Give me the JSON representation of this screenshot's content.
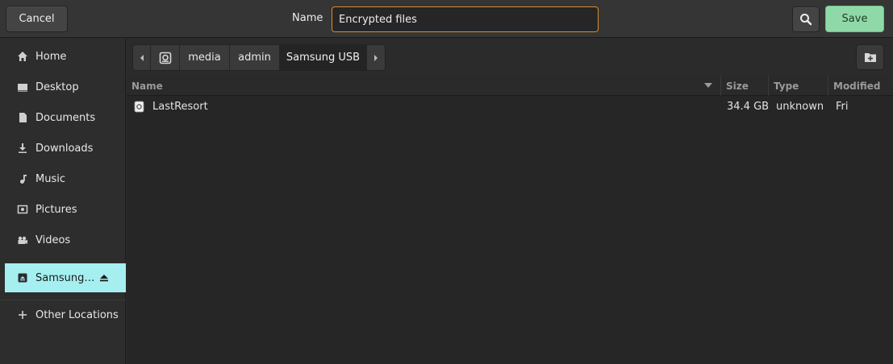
{
  "header": {
    "cancel_label": "Cancel",
    "name_label": "Name",
    "name_value": "Encrypted files",
    "save_label": "Save",
    "search_icon": "search-icon"
  },
  "sidebar": {
    "items": [
      {
        "label": "Home",
        "icon": "home-icon"
      },
      {
        "label": "Desktop",
        "icon": "desktop-icon"
      },
      {
        "label": "Documents",
        "icon": "document-icon"
      },
      {
        "label": "Downloads",
        "icon": "download-icon"
      },
      {
        "label": "Music",
        "icon": "music-icon"
      },
      {
        "label": "Pictures",
        "icon": "pictures-icon"
      },
      {
        "label": "Videos",
        "icon": "videos-icon"
      },
      {
        "label": "Samsung…",
        "icon": "drive-icon",
        "active": true,
        "eject": true
      },
      {
        "label": "Other Locations",
        "icon": "plus-icon"
      }
    ]
  },
  "pathbar": {
    "segments": [
      "media",
      "admin",
      "Samsung USB"
    ],
    "current": "Samsung USB"
  },
  "filelist": {
    "columns": [
      "Name",
      "Size",
      "Type",
      "Modified"
    ],
    "rows": [
      {
        "name": "LastResort",
        "size": "34.4 GB",
        "type": "unknown",
        "modified": "Fri"
      }
    ]
  },
  "colors": {
    "accent": "#a5eff0",
    "save": "#8fd9a8",
    "focus": "#d98c2b"
  }
}
